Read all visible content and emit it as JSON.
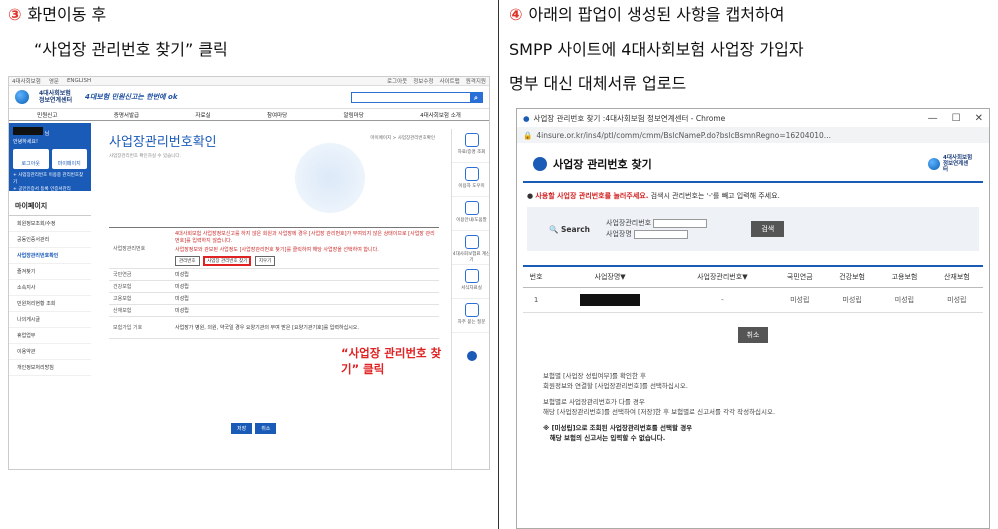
{
  "left": {
    "step_num": "③",
    "step_text": "화면이동 후",
    "step_line2": "“사업장 관리번호 찾기” 클릭",
    "shot": {
      "topbar": {
        "t1": "4대사회보험",
        "t2": "영문",
        "t3": "ENGLISH",
        "r": [
          "로그아웃",
          "정보수정",
          "사이트맵",
          "원격지원"
        ]
      },
      "logo": "4대사회보험 정보연계센터",
      "tagline": "4대보험 민원신고는 한번에 ok",
      "gnb": [
        "민원신고",
        "증명서발급",
        "자료실",
        "참여마당",
        "알림마당",
        "4대사회보험 소개"
      ],
      "login": {
        "suffix": "님",
        "welcome": "안녕하세요!",
        "b1": "로그아웃",
        "b2": "마이페이지",
        "l1": "+ 사업장관리번호 이용중",
        "l2": "관리번호찾기",
        "l3": "+ 공인인증서 등록",
        "l4": "인증서관리",
        "l5": "+ 최근접속 조회하기",
        "l6": "회원정보"
      },
      "side_title": "마이페이지",
      "side_items": [
        "회원정보조회/수정",
        "공동인증서관리",
        "사업장관리번호확인",
        "즐겨찾기",
        "소속지사",
        "민원처리현황 조회",
        "나의게시글",
        "휴업업무",
        "이용약관",
        "개인정보처리방침"
      ],
      "title": "사업장관리번호확인",
      "bread": "마이페이지 > 사업장관리번호확인",
      "desc": "사업장관리번호 확인하실 수 있습니다.",
      "warn1": "4대사회보험 사업장정보신고를 하지 않은 회원과 사업장에 경우 [사업장 관리번호]가 부여되지 않은 상태이므로 [사업장 관리번호]를 입력하지 않습니다.",
      "warn2": "사업장정보와 관보된 사업정도 [사업장관리번호 찾기]를 클릭하여 해당 사업장을 선택하여 합니다.",
      "f_k1": "사업장관리번호",
      "b_find1": "관리번호",
      "b_find2": "사업장 관리번호 찾기",
      "b_find3": "지우기",
      "rows": [
        {
          "k": "국민연금",
          "v": "미성립"
        },
        {
          "k": "건강보험",
          "v": "미성립"
        },
        {
          "k": "고용보험",
          "v": "미성립"
        },
        {
          "k": "산재보험",
          "v": "미성립"
        }
      ],
      "f_k2": "보험가입 기호",
      "warn3": "사업장가 병원, 의원, 약국일 경우 요양기관의 부여 받은 [요양기관기호]를 입력하십시오.",
      "btn_save": "저장",
      "btn_cancel": "취소",
      "callout": "“사업장 관리번호 찾기” 클릭",
      "quick": [
        "자료/증명 조회",
        "이용자 도우미",
        "이용안내/도움말",
        "4대사회보험료 계산기",
        "서식자료실",
        "자주 묻는 질문"
      ]
    }
  },
  "right": {
    "step_num": "④",
    "line1": "아래의 팝업이 생성된 사항을 캡처하여",
    "line2": "SMPP 사이트에 4대사회보험 사업장 가입자",
    "line3": "명부 대신 대체서류 업로드",
    "popup": {
      "win_title": "사업장 관리번호 찾기 :4대사회보험 정보연계센터 - Chrome",
      "ctl": [
        "—",
        "☐",
        "✕"
      ],
      "url": "4insure.or.kr/ins4/ptl/comm/cmm/BslcNameP.do?bslcBsmnRegno=16204010...",
      "title": "사업장 관리번호 찾기",
      "logo": "4대사회보험 정보연계센터",
      "notice_red": "사용할 사업장 관리번호를 눌러주세요.",
      "notice_rest": " 검색시 관리번호는 '-'를 빼고 입력해 주세요.",
      "search_label": "Search",
      "f1": "사업장관리번호",
      "f2": "사업장명",
      "search_btn": "검색",
      "cols": [
        "번호",
        "사업장명▼",
        "사업장관리번호▼",
        "국민연금",
        "건강보험",
        "고용보험",
        "산재보험"
      ],
      "row": {
        "no": "1",
        "mgmt": "-",
        "s1": "미성립",
        "s2": "미성립",
        "s3": "미성립",
        "s4": "미성립"
      },
      "cancel": "취소",
      "info1": "보험별 [사업장 성립여부]를 확인한 후",
      "info2": "회원정보와 연결할 [사업장관리번호]를 선택하십시오.",
      "info3": "보험별로 사업장관리번호가 다를 경우",
      "info4": "해당 [사업장관리번호]를 선택하여 [저장]한 후 보험별로 신고서를 각각 작성하십시오.",
      "info5": "※ [미성립]으로 조회된 사업장관리번호를 선택할 경우",
      "info6": "해당 보험의 신고서는 입력할 수 없습니다."
    }
  }
}
